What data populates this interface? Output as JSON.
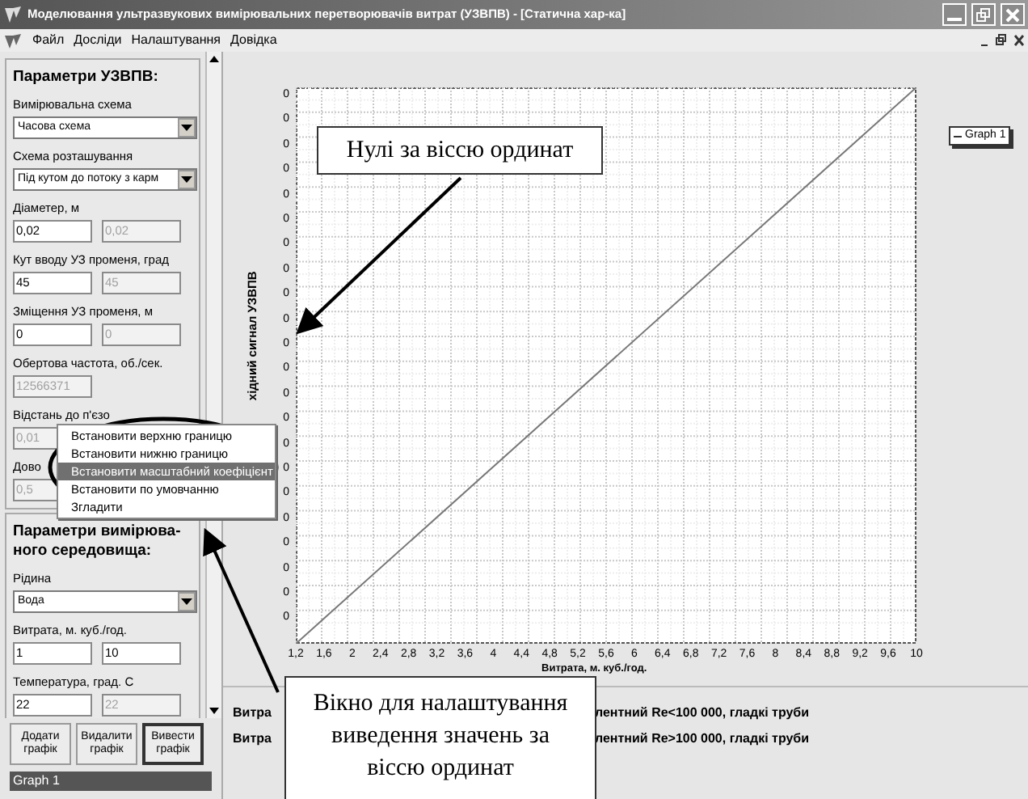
{
  "window": {
    "title": "Моделювання ультразвукових вимірювальних перетворювачів витрат (УЗВПВ) - [Статична хар-ка]"
  },
  "menu_bar": [
    "Файл",
    "Досліди",
    "Налаштування",
    "Довідка"
  ],
  "panels": [
    {
      "title": "Параметри УЗВПВ:",
      "fields": [
        {
          "kind": "select",
          "label": "Вимірювальна схема",
          "value": "Часова схема"
        },
        {
          "kind": "select",
          "label": "Схема розташування",
          "value": "Під кутом до потоку з карм"
        },
        {
          "kind": "pair",
          "label": "Діаметер, м",
          "inputs": [
            {
              "value": "0,02",
              "disabled": false
            },
            {
              "value": "0,02",
              "disabled": true
            }
          ]
        },
        {
          "kind": "pair",
          "label": "Кут вводу УЗ променя, град",
          "inputs": [
            {
              "value": "45",
              "disabled": false
            },
            {
              "value": "45",
              "disabled": true
            }
          ]
        },
        {
          "kind": "pair",
          "label": "Зміщення УЗ променя, м",
          "inputs": [
            {
              "value": "0",
              "disabled": false
            },
            {
              "value": "0",
              "disabled": true
            }
          ]
        },
        {
          "kind": "pair",
          "label": "Обертова частота, об./сек.",
          "inputs": [
            {
              "value": "12566371",
              "disabled": true
            }
          ]
        },
        {
          "kind": "pair",
          "label": "Відстань до п'єзо",
          "inputs": [
            {
              "value": "0,01",
              "disabled": true
            }
          ]
        },
        {
          "kind": "pair",
          "label": "Дово",
          "inputs": [
            {
              "value": "0,5",
              "disabled": true
            }
          ]
        }
      ]
    },
    {
      "title": "Параметри вимірюва-ного середовища:",
      "fields": [
        {
          "kind": "select",
          "label": "Рідина",
          "value": "Вода"
        },
        {
          "kind": "pair",
          "label": "Витрата, м. куб./год.",
          "inputs": [
            {
              "value": "1",
              "disabled": false
            },
            {
              "value": "10",
              "disabled": false
            }
          ]
        },
        {
          "kind": "pair",
          "label": "Температура, град. С",
          "inputs": [
            {
              "value": "22",
              "disabled": false
            },
            {
              "value": "22",
              "disabled": true
            }
          ]
        }
      ]
    }
  ],
  "buttons": [
    {
      "label": "Додати графік",
      "default": false
    },
    {
      "label": "Видалити графік",
      "default": false
    },
    {
      "label": "Вивести графік",
      "default": true
    }
  ],
  "graph_list": [
    {
      "label": "Graph 1",
      "selected": true
    }
  ],
  "chart": {
    "ylabel": "хідний сигнал УЗВПВ",
    "xlabel": "Витрата, м. куб./год.",
    "y_tick_labels": [
      "0",
      "0",
      "0",
      "0",
      "0",
      "0",
      "0",
      "0",
      "0",
      "0",
      "0",
      "0",
      "0",
      "0",
      "0",
      "0",
      "0",
      "0",
      "0",
      "0",
      "0",
      "0"
    ],
    "x_tick_labels": [
      "1,2",
      "1,6",
      "2",
      "2,4",
      "2,8",
      "3,2",
      "3,6",
      "4",
      "4,4",
      "4,8",
      "5,2",
      "5,6",
      "6",
      "6,4",
      "6,8",
      "7,2",
      "7,6",
      "8",
      "8,4",
      "8,8",
      "9,2",
      "9,6",
      "10"
    ],
    "legend": [
      "Graph 1"
    ]
  },
  "results": [
    {
      "left": "Витра",
      "right": "лентний Re<100 000, гладкі труби"
    },
    {
      "left": "Витра",
      "right": "лентний Re>100 000, гладкі труби"
    }
  ],
  "context_menu": [
    {
      "label": "Встановити верхню границю",
      "selected": false
    },
    {
      "label": "Встановити нижню границю",
      "selected": false
    },
    {
      "label": "Встановити масштабний коефіцієнт",
      "selected": true
    },
    {
      "label": "Встановити по умовчанню",
      "selected": false
    },
    {
      "label": "Згладити",
      "selected": false
    }
  ],
  "callouts": [
    {
      "text": "Нулі за віссю ординат"
    },
    {
      "text": "Вікно для налаштування виведення значень за віссю ординат"
    }
  ]
}
